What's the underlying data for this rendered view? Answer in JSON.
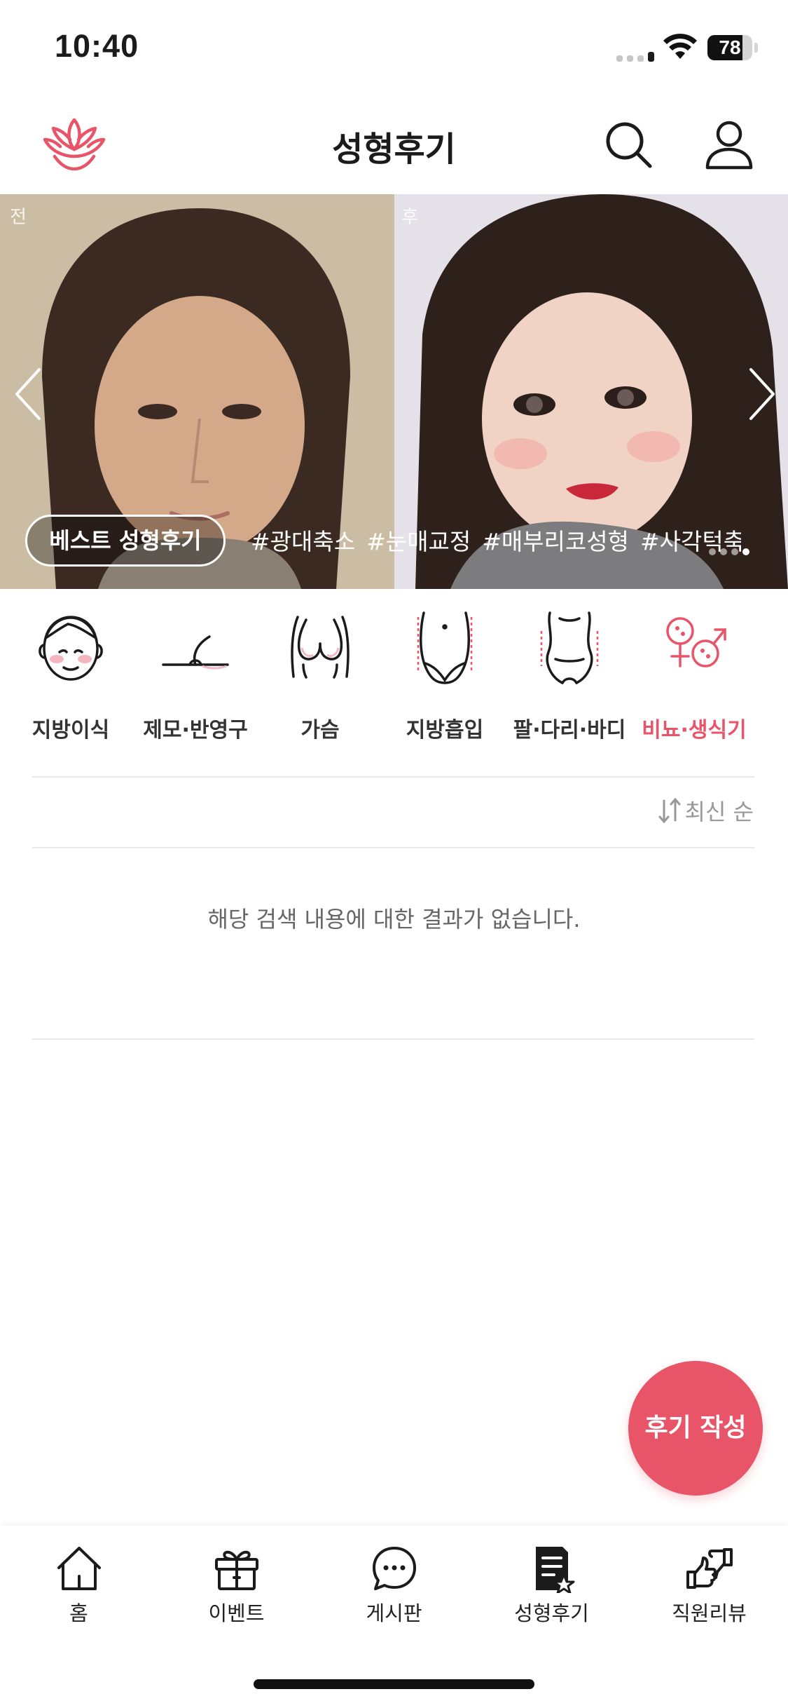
{
  "status_bar": {
    "time": "10:40",
    "battery": "78",
    "battery_level": 0.78
  },
  "header": {
    "title": "성형후기",
    "logo_icon": "lotus-logo-icon",
    "search_icon": "search-icon",
    "profile_icon": "user-icon"
  },
  "banner": {
    "before_label": "전",
    "after_label": "후",
    "best_button": "베스트 성형후기",
    "tags": [
      "#광대축소",
      "#눈매교정",
      "#매부리코성형",
      "#사각턱축소"
    ],
    "page_count": 4,
    "active_page": 4,
    "prev_icon": "chevron-left-icon",
    "next_icon": "chevron-right-icon"
  },
  "categories": [
    {
      "label": "지방이식",
      "icon": "face-icon",
      "active": false
    },
    {
      "label": "제모·반영구",
      "icon": "hair-removal-icon",
      "active": false
    },
    {
      "label": "가슴",
      "icon": "chest-icon",
      "active": false
    },
    {
      "label": "지방흡입",
      "icon": "liposuction-icon",
      "active": false
    },
    {
      "label": "팔·다리·바디",
      "icon": "body-icon",
      "active": false
    },
    {
      "label": "비뇨·생식기",
      "icon": "urology-icon",
      "active": true
    }
  ],
  "sort": {
    "label": "최신 순",
    "icon": "sort-icon"
  },
  "empty_message": "해당 검색 내용에 대한 결과가 없습니다.",
  "fab": {
    "label": "후기 작성"
  },
  "tabs": [
    {
      "label": "홈",
      "icon": "home-icon"
    },
    {
      "label": "이벤트",
      "icon": "gift-icon"
    },
    {
      "label": "게시판",
      "icon": "chat-icon"
    },
    {
      "label": "성형후기",
      "icon": "review-doc-icon",
      "active": true
    },
    {
      "label": "직원리뷰",
      "icon": "thumbs-icon"
    }
  ],
  "colors": {
    "accent": "#e85468",
    "text": "#1b1b1b",
    "muted": "#999999",
    "divider": "#e9e9e9"
  }
}
